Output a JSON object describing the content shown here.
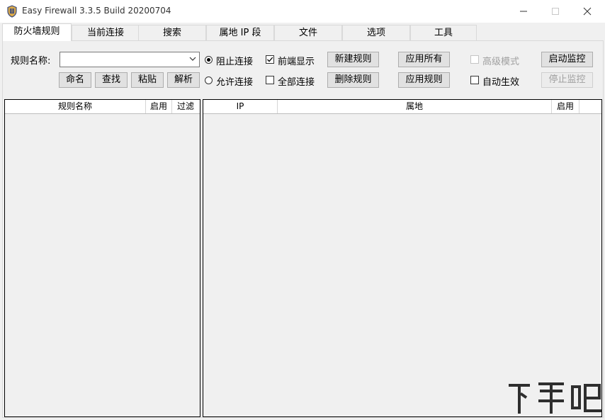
{
  "window": {
    "title": "Easy Firewall 3.3.5 Build 20200704"
  },
  "tabs": [
    {
      "label": "防火墙规则",
      "active": true
    },
    {
      "label": "当前连接"
    },
    {
      "label": "搜索"
    },
    {
      "label": "属地 IP 段"
    },
    {
      "label": "文件"
    },
    {
      "label": "选项"
    },
    {
      "label": "工具"
    }
  ],
  "rule_form": {
    "name_label": "规则名称:",
    "name_value": "",
    "buttons": {
      "rename": "命名",
      "find": "查找",
      "paste": "粘贴",
      "parse": "解析"
    }
  },
  "connection_mode": {
    "block_label": "阻止连接",
    "block_selected": true,
    "allow_label": "允许连接",
    "allow_selected": false
  },
  "display_options": {
    "foreground_label": "前端显示",
    "foreground_checked": true,
    "all_connections_label": "全部连接",
    "all_connections_checked": false
  },
  "actions": {
    "new_rule": "新建规则",
    "delete_rule": "删除规则",
    "apply_all": "应用所有",
    "apply_rule": "应用规则",
    "advanced_mode_label": "高级模式",
    "advanced_mode_enabled": false,
    "auto_apply_label": "自动生效",
    "auto_apply_checked": false,
    "start_monitor": "启动监控",
    "stop_monitor": "停止监控"
  },
  "rules_list": {
    "columns": [
      "规则名称",
      "启用",
      "过滤"
    ],
    "rows": []
  },
  "ip_list": {
    "columns": [
      "IP",
      "属地",
      "启用"
    ],
    "rows": []
  },
  "watermark": {
    "text": "下载吧"
  }
}
